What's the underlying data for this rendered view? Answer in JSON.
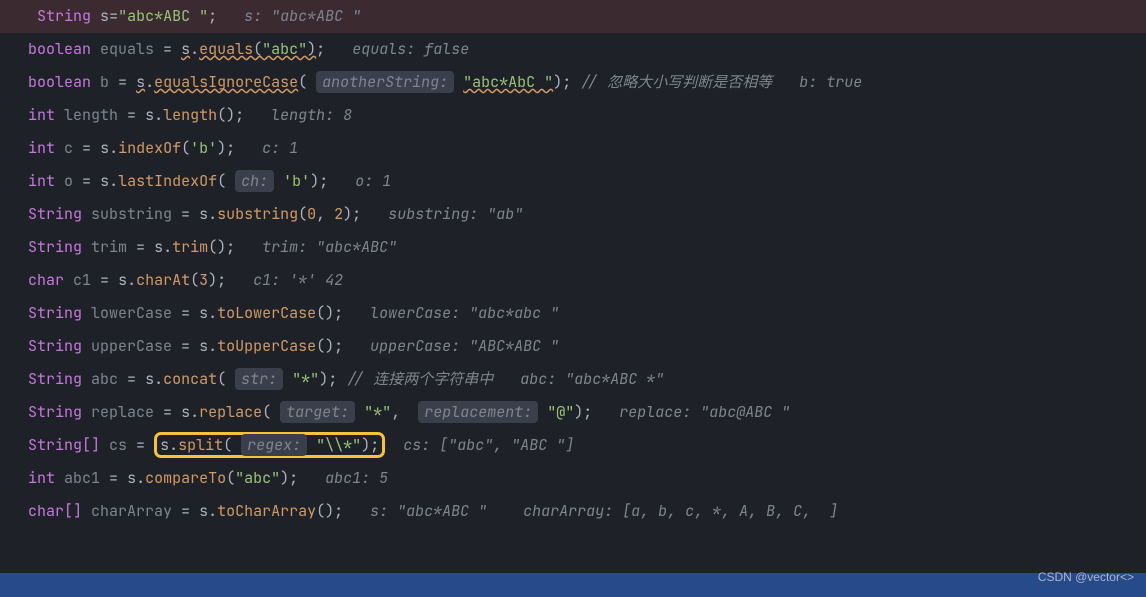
{
  "lines": {
    "l1": {
      "kw": "String",
      "var": "s",
      "eq": "=",
      "s": "\"abc*ABC \"",
      "end": ";",
      "hint": "s: \"abc*ABC \""
    },
    "l2": {
      "kw": "boolean",
      "var": "equals",
      "eq": " = ",
      "obj": "s",
      "m": "equals",
      "a": "\"abc\"",
      "end": ";",
      "hint": "equals: false"
    },
    "l3": {
      "kw": "boolean",
      "var": "b",
      "eq": " = ",
      "obj": "s",
      "m": "equalsIgnoreCase",
      "pk": "anotherString:",
      "a": "\"abc*AbC \"",
      "end": "; ",
      "cm": "// ",
      "cn": "忽略大小写判断是否相等",
      "hint": "b: true"
    },
    "l4": {
      "kw": "int",
      "var": "length",
      "eq": " = ",
      "obj": "s",
      "m": "length",
      "end": "();",
      "hint": "length: 8"
    },
    "l5": {
      "kw": "int",
      "var": "c",
      "eq": " = ",
      "obj": "s",
      "m": "indexOf",
      "a": "'b'",
      "end": ");",
      "hint": "c: 1"
    },
    "l6": {
      "kw": "int",
      "var": "o",
      "eq": " = ",
      "obj": "s",
      "m": "lastIndexOf",
      "pk": "ch:",
      "a": "'b'",
      "end": ");",
      "hint": "o: 1"
    },
    "l7": {
      "kw": "String",
      "var": "substring",
      "eq": " = ",
      "obj": "s",
      "m": "substring",
      "a1": "0",
      "c": ", ",
      "a2": "2",
      "end": ");",
      "hint": "substring: \"ab\""
    },
    "l8": {
      "kw": "String",
      "var": "trim",
      "eq": " = ",
      "obj": "s",
      "m": "trim",
      "end": "();",
      "hint": "trim: \"abc*ABC\""
    },
    "l9": {
      "kw": "char",
      "var": "c1",
      "eq": " = ",
      "obj": "s",
      "m": "charAt",
      "a": "3",
      "end": ");",
      "hint": "c1: '*' 42"
    },
    "l10": {
      "kw": "String",
      "var": "lowerCase",
      "eq": " = ",
      "obj": "s",
      "m": "toLowerCase",
      "end": "();",
      "hint": "lowerCase: \"abc*abc \""
    },
    "l11": {
      "kw": "String",
      "var": "upperCase",
      "eq": " = ",
      "obj": "s",
      "m": "toUpperCase",
      "end": "();",
      "hint": "upperCase: \"ABC*ABC \""
    },
    "l12": {
      "kw": "String",
      "var": "abc",
      "eq": " = ",
      "obj": "s",
      "m": "concat",
      "pk": "str:",
      "a": "\"*\"",
      "end": "); ",
      "cm": "// ",
      "cn": "连接两个字符串中",
      "hint": "abc: \"abc*ABC *\""
    },
    "l13": {
      "kw": "String",
      "var": "replace",
      "eq": " = ",
      "obj": "s",
      "m": "replace",
      "pk1": "target:",
      "a1": "\"*\"",
      "c": ", ",
      "pk2": "replacement:",
      "a2": "\"@\"",
      "end": ");",
      "hint": "replace: \"abc@ABC \""
    },
    "l14": {
      "kw": "String[]",
      "var": "cs",
      "eq": " = ",
      "obj": "s",
      "m": "split",
      "pk": "regex:",
      "a": "\"\\\\*\"",
      "end": ");",
      "hint": "cs: [\"abc\", \"ABC \"]"
    },
    "l15": {
      "kw": "int",
      "var": "abc1",
      "eq": " = ",
      "obj": "s",
      "m": "compareTo",
      "a": "\"abc\"",
      "end": ");",
      "hint": "abc1: 5"
    },
    "l16": {
      "kw": "char[]",
      "var": "charArray",
      "eq": " = ",
      "obj": "s",
      "m": "toCharArray",
      "end": "();",
      "h1": "s: \"abc*ABC \"",
      "h2": "charArray: [a, b, c, *, A, B, C,  ]"
    }
  },
  "watermark": "CSDN @vector<>"
}
